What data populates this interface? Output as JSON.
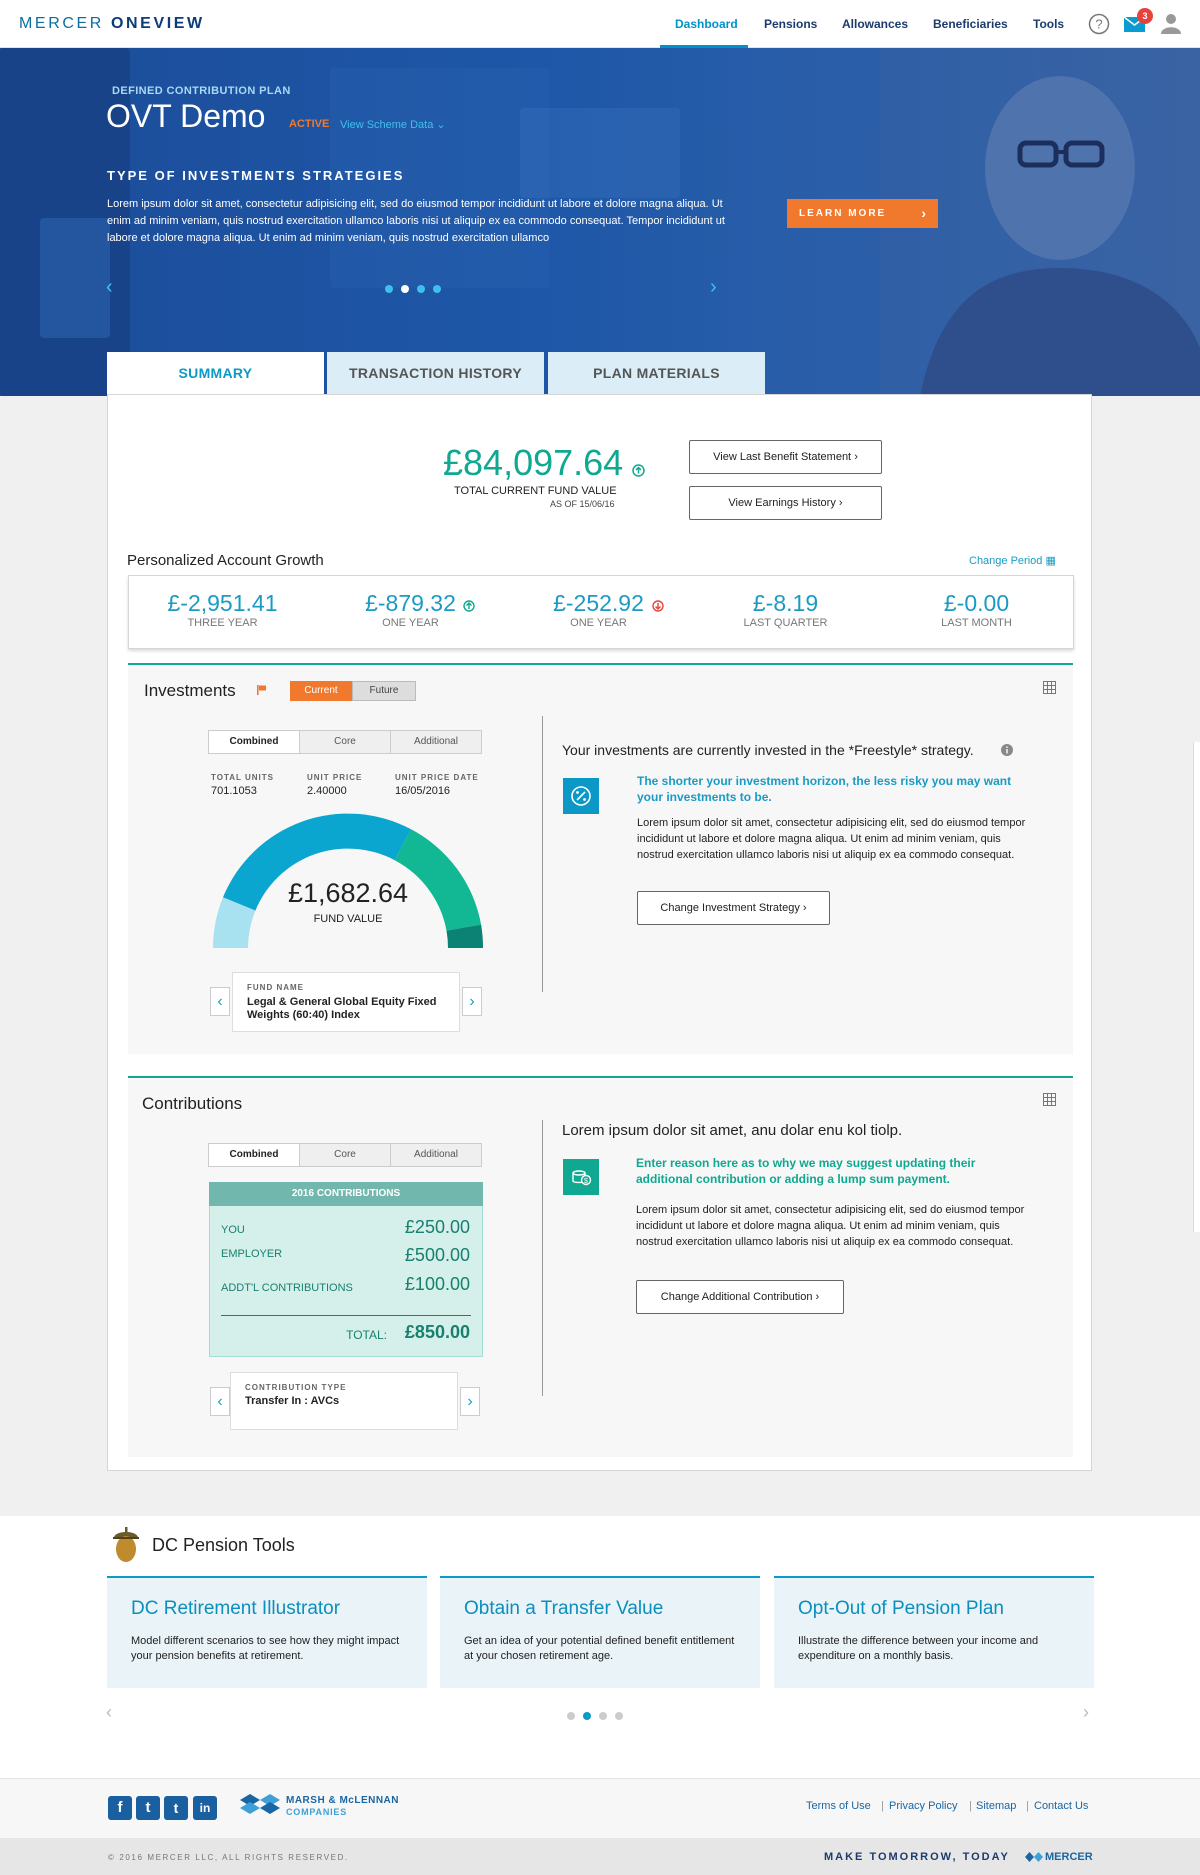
{
  "nav": {
    "logo_part1": "MERCER",
    "logo_part2": "ONEVIEW",
    "items": [
      "Dashboard",
      "Pensions",
      "Allowances",
      "Beneficiaries",
      "Tools"
    ],
    "mail_count": "3"
  },
  "hero": {
    "plan_type": "DEFINED CONTRIBUTION PLAN",
    "plan_name": "OVT Demo",
    "status": "ACTIVE",
    "scheme_link": "View Scheme Data",
    "heading": "TYPE OF INVESTMENTS STRATEGIES",
    "body": "Lorem ipsum dolor sit amet, consectetur adipisicing elit, sed do eiusmod tempor incididunt ut labore et dolore magna aliqua. Ut enim ad minim veniam, quis nostrud exercitation ullamco laboris nisi ut aliquip ex ea commodo consequat. Tempor incididunt ut labore et dolore magna aliqua. Ut enim ad minim veniam, quis nostrud exercitation ullamco",
    "cta": "LEARN MORE"
  },
  "tabs": [
    "SUMMARY",
    "TRANSACTION HISTORY",
    "PLAN MATERIALS"
  ],
  "summary": {
    "fund_value": "£84,097.64",
    "fund_label": "TOTAL CURRENT FUND VALUE",
    "as_of": "AS OF 15/06/16",
    "btn_statement": "View Last Benefit Statement",
    "btn_earnings": "View Earnings History"
  },
  "growth": {
    "title": "Personalized Account Growth",
    "change_period": "Change Period",
    "items": [
      {
        "value": "£-2,951.41",
        "label": "THREE YEAR"
      },
      {
        "value": "£-879.32",
        "label": "ONE YEAR"
      },
      {
        "value": "£-252.92",
        "label": "ONE YEAR"
      },
      {
        "value": "£-8.19",
        "label": "LAST QUARTER"
      },
      {
        "value": "£-0.00",
        "label": "LAST MONTH"
      }
    ]
  },
  "investments": {
    "title": "Investments",
    "toggle_current": "Current",
    "toggle_future": "Future",
    "segments": [
      "Combined",
      "Core",
      "Additional"
    ],
    "total_units_label": "TOTAL UNITS",
    "total_units": "701.1053",
    "unit_price_label": "UNIT PRICE",
    "unit_price": "2.40000",
    "unit_price_date_label": "UNIT PRICE DATE",
    "unit_price_date": "16/05/2016",
    "fund_value": "£1,682.64",
    "fund_value_label": "FUND VALUE",
    "fund_name_label": "FUND NAME",
    "fund_name": "Legal & General Global Equity Fixed Weights (60:40) Index",
    "strategy_text": "Your investments are currently invested in the *Freestyle* strategy.",
    "tip_heading": "The shorter your investment horizon, the less risky you may want your investments to be.",
    "tip_body": "Lorem ipsum dolor sit amet, consectetur adipisicing elit, sed do eiusmod tempor incididunt ut labore et dolore magna aliqua. Ut enim ad minim veniam, quis nostrud exercitation ullamco laboris nisi ut aliquip ex ea commodo consequat.",
    "btn": "Change Investment Strategy"
  },
  "contributions": {
    "title": "Contributions",
    "segments": [
      "Combined",
      "Core",
      "Additional"
    ],
    "box_title": "2016 CONTRIBUTIONS",
    "rows": [
      {
        "label": "YOU",
        "value": "£250.00"
      },
      {
        "label": "EMPLOYER",
        "value": "£500.00"
      },
      {
        "label": "ADDT'L CONTRIBUTIONS",
        "value": "£100.00"
      }
    ],
    "total_label": "TOTAL:",
    "total_value": "£850.00",
    "type_label": "CONTRIBUTION TYPE",
    "type_value": "Transfer In : AVCs",
    "heading": "Lorem ipsum dolor sit amet, anu dolar enu kol tiolp.",
    "tip_heading": "Enter reason here as to why we may suggest updating their additional contribution or adding a lump sum payment.",
    "tip_body": "Lorem ipsum dolor sit amet, consectetur adipisicing elit, sed do eiusmod tempor incididunt ut labore et dolore magna aliqua. Ut enim ad minim veniam, quis nostrud exercitation ullamco laboris nisi ut aliquip ex ea commodo consequat.",
    "btn": "Change Additional Contribution"
  },
  "tools": {
    "title": "DC Pension Tools",
    "cards": [
      {
        "title": "DC Retirement Illustrator",
        "text": "Model different scenarios to see how they might impact your pension benefits at retirement."
      },
      {
        "title": "Obtain a Transfer Value",
        "text": "Get an idea of your potential defined benefit entitlement at your chosen retirement age."
      },
      {
        "title": "Opt-Out of Pension Plan",
        "text": "Illustrate the difference between your income and expenditure on a monthly basis."
      }
    ]
  },
  "footer": {
    "brand_line1": "MARSH & McLENNAN",
    "brand_line2": "COMPANIES",
    "links": [
      "Terms of Use",
      "Privacy Policy",
      "Sitemap",
      "Contact Us"
    ],
    "copyright": "© 2016 MERCER LLC, ALL RIGHTS RESERVED.",
    "tagline": "MAKE TOMORROW, TODAY",
    "mercer": "MERCER"
  },
  "colors": {
    "brand_blue": "#0093c9",
    "teal": "#10a890",
    "orange": "#f0792e",
    "navy": "#1c3b6d"
  }
}
